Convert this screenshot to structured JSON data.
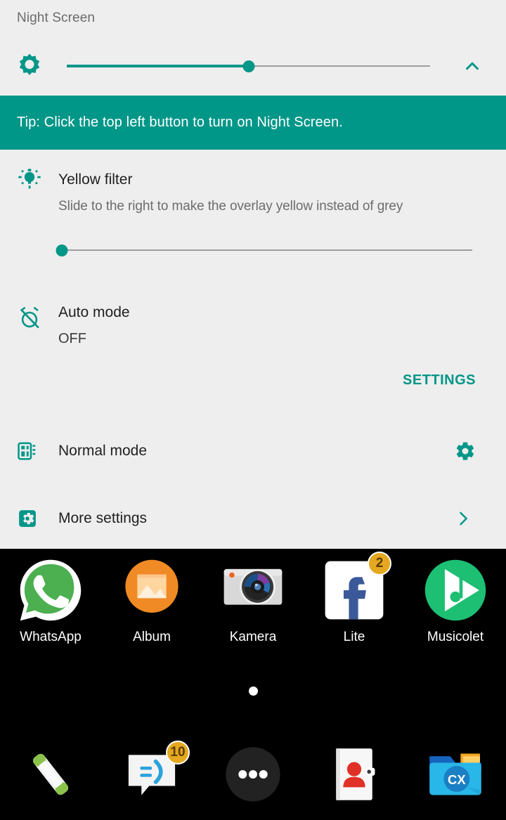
{
  "panel": {
    "title": "Night Screen",
    "accent_color": "#009688",
    "background_color": "#eeeeee",
    "brightness": {
      "icon": "brightness-sun-icon",
      "value_percent": 50,
      "collapse_icon": "chevron-up-icon"
    },
    "tip": {
      "text": "Tip: Click the top left button to turn on Night Screen.",
      "background_color": "#009688",
      "text_color": "#ffffff"
    },
    "yellow_filter": {
      "icon": "lightbulb-icon",
      "title": "Yellow filter",
      "description": "Slide to the right to make the overlay yellow instead of grey",
      "value_percent": 0
    },
    "auto_mode": {
      "icon": "alarm-off-icon",
      "title": "Auto mode",
      "value": "OFF",
      "settings_label": "SETTINGS"
    },
    "normal_mode": {
      "icon": "layout-mode-icon",
      "label": "Normal mode",
      "action_icon": "gear-icon"
    },
    "more_settings": {
      "icon": "settings-square-icon",
      "label": "More settings",
      "action_icon": "chevron-right-icon"
    }
  },
  "home": {
    "apps": [
      {
        "label": "WhatsApp",
        "icon": "whatsapp-icon",
        "badge": ""
      },
      {
        "label": "Album",
        "icon": "album-gallery-icon",
        "badge": ""
      },
      {
        "label": "Kamera",
        "icon": "camera-icon",
        "badge": ""
      },
      {
        "label": "Lite",
        "icon": "facebook-lite-icon",
        "badge": "2"
      },
      {
        "label": "Musicolet",
        "icon": "musicolet-icon",
        "badge": ""
      }
    ],
    "page_indicator": {
      "pages": 1,
      "current": 1
    },
    "dock": [
      {
        "name": "phone",
        "icon": "phone-handset-icon",
        "badge": ""
      },
      {
        "name": "messaging",
        "icon": "messaging-icon",
        "badge": "10"
      },
      {
        "name": "app-drawer",
        "icon": "app-drawer-icon",
        "badge": ""
      },
      {
        "name": "contacts",
        "icon": "contacts-book-icon",
        "badge": ""
      },
      {
        "name": "cx-file-explorer",
        "icon": "cx-folder-icon",
        "badge": ""
      }
    ]
  }
}
